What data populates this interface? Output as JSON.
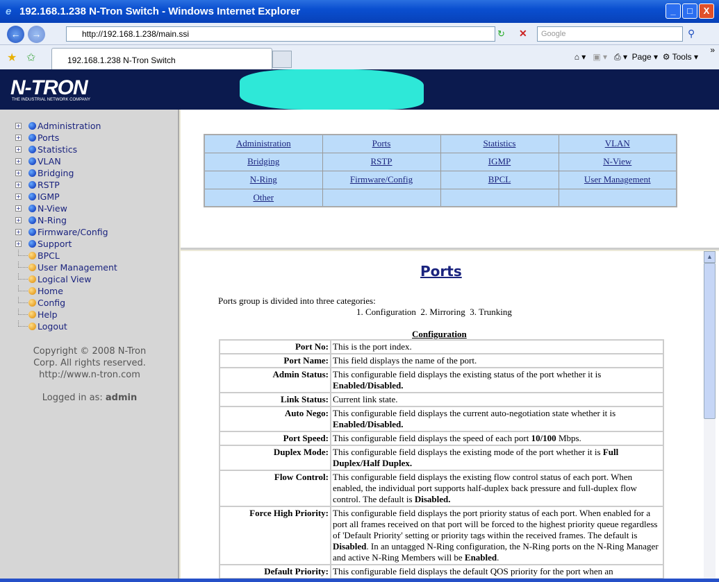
{
  "window": {
    "title": "192.168.1.238 N-Tron Switch - Windows Internet Explorer",
    "min": "_",
    "max": "□",
    "close": "X"
  },
  "browser": {
    "url": "http://192.168.1.238/main.ssi",
    "search_placeholder": "Google",
    "tab": "192.168.1.238 N-Tron Switch",
    "page_menu": "Page",
    "tools_menu": "Tools",
    "more": "»"
  },
  "banner": {
    "logo": "N-TRON",
    "tagline": "THE INDUSTRIAL NETWORK COMPANY"
  },
  "sidebar": {
    "items": [
      {
        "label": "Administration",
        "type": "folder"
      },
      {
        "label": "Ports",
        "type": "folder"
      },
      {
        "label": "Statistics",
        "type": "folder"
      },
      {
        "label": "VLAN",
        "type": "folder"
      },
      {
        "label": "Bridging",
        "type": "folder"
      },
      {
        "label": "RSTP",
        "type": "folder"
      },
      {
        "label": "IGMP",
        "type": "folder"
      },
      {
        "label": "N-View",
        "type": "folder"
      },
      {
        "label": "N-Ring",
        "type": "folder"
      },
      {
        "label": "Firmware/Config",
        "type": "folder"
      },
      {
        "label": "Support",
        "type": "folder"
      },
      {
        "label": "BPCL",
        "type": "page"
      },
      {
        "label": "User Management",
        "type": "page"
      },
      {
        "label": "Logical View",
        "type": "page"
      },
      {
        "label": "Home",
        "type": "page"
      },
      {
        "label": "Config",
        "type": "page"
      },
      {
        "label": "Help",
        "type": "page"
      },
      {
        "label": "Logout",
        "type": "page"
      }
    ],
    "copyright": [
      "Copyright © 2008 N-Tron",
      "Corp. All rights reserved.",
      "http://www.n-tron.com"
    ],
    "logged_label": "Logged in as:",
    "user": "admin"
  },
  "nav": [
    [
      "Administration",
      "Ports",
      "Statistics",
      "VLAN"
    ],
    [
      "Bridging",
      "RSTP",
      "IGMP",
      "N-View"
    ],
    [
      "N-Ring",
      "Firmware/Config",
      "BPCL",
      "User Management"
    ],
    [
      "Other",
      "",
      "",
      ""
    ]
  ],
  "main": {
    "title": "Ports",
    "intro": "Ports group is divided into three categories:",
    "categories": "1. Configuration  2. Mirroring  3. Trunking",
    "section": "Configuration",
    "rows": [
      {
        "k": "Port No:",
        "v": "This is the port index."
      },
      {
        "k": "Port Name:",
        "v": "This field displays the name of the port."
      },
      {
        "k": "Admin Status:",
        "v": "This configurable field displays the existing status of the port whether it is <b>Enabled/Disabled.</b>"
      },
      {
        "k": "Link Status:",
        "v": "Current link state."
      },
      {
        "k": "Auto Nego:",
        "v": "This configurable field displays the current auto-negotiation state whether it is <b>Enabled/Disabled.</b>"
      },
      {
        "k": "Port Speed:",
        "v": "This configurable field displays the speed of each port <b>10/100</b> Mbps."
      },
      {
        "k": "Duplex Mode:",
        "v": "This configurable field displays the existing mode of the port whether it is <b>Full Duplex/Half Duplex.</b>"
      },
      {
        "k": "Flow Control:",
        "v": "This configurable field displays the existing flow control status of each port. When enabled, the individual port supports half-duplex back pressure and full-duplex flow control. The default is <b>Disabled.</b>"
      },
      {
        "k": "Force High Priority:",
        "v": "This configurable field displays the port priority status of each port. When enabled for a port all frames received on that port will be forced to the highest priority queue regardless of 'Default Priority' setting or priority tags within the received frames. The default is <b>Disabled</b>. In an untagged N-Ring configuration, the N-Ring ports on the N-Ring Manager and active N-Ring Members will be <b>Enabled</b>."
      },
      {
        "k": "Default Priority:",
        "v": "This configurable field displays the default QOS priority for the port when an"
      }
    ]
  }
}
